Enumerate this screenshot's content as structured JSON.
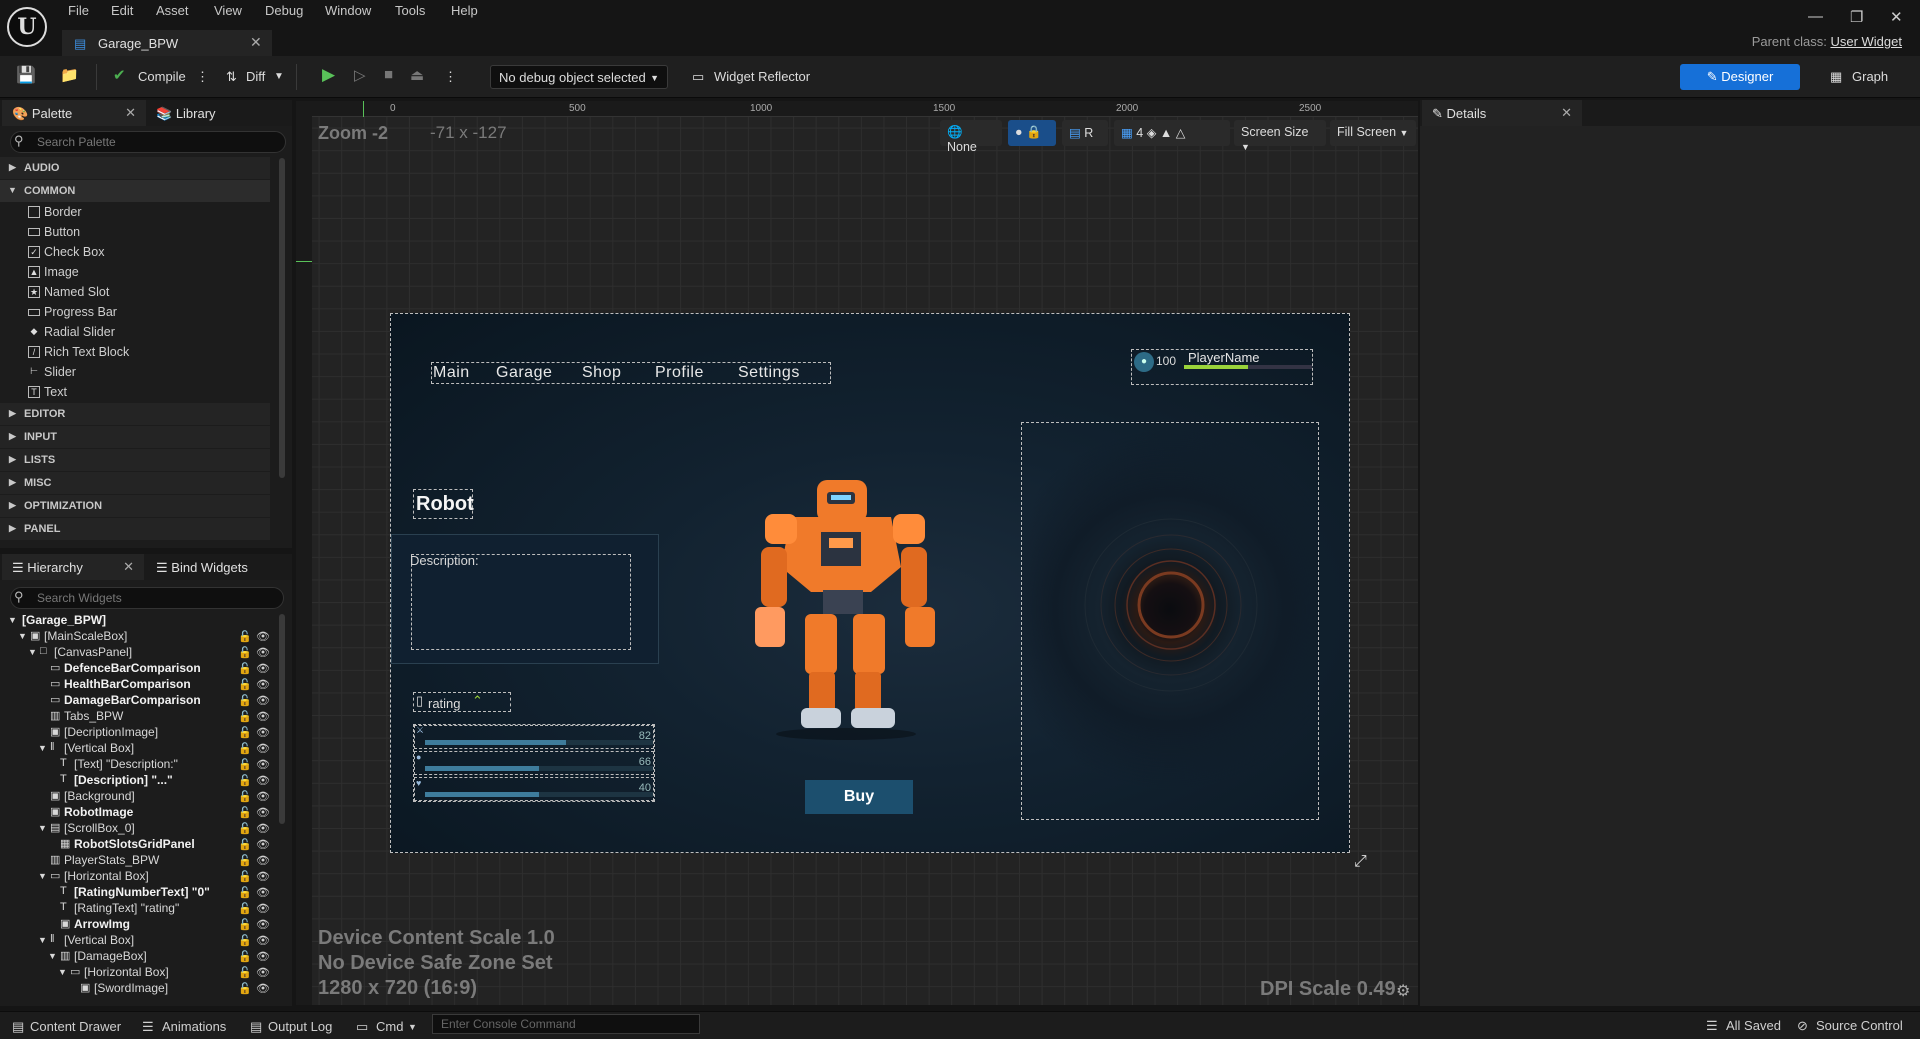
{
  "menu": [
    "File",
    "Edit",
    "Asset",
    "View",
    "Debug",
    "Window",
    "Tools",
    "Help"
  ],
  "document_tab": "Garage_BPW",
  "parent_class_label": "Parent class:",
  "parent_class_value": "User Widget",
  "toolbar": {
    "compile": "Compile",
    "diff": "Diff",
    "debug_object": "No debug object selected",
    "widget_reflector": "Widget Reflector",
    "designer": "Designer",
    "graph": "Graph"
  },
  "palette": {
    "tab": "Palette",
    "library_tab": "Library",
    "search_placeholder": "Search Palette",
    "categories": [
      "AUDIO",
      "COMMON",
      "EDITOR",
      "INPUT",
      "LISTS",
      "MISC",
      "OPTIMIZATION",
      "PANEL"
    ],
    "common_items": [
      "Border",
      "Button",
      "Check Box",
      "Image",
      "Named Slot",
      "Progress Bar",
      "Radial Slider",
      "Rich Text Block",
      "Slider",
      "Text"
    ]
  },
  "hierarchy": {
    "tab": "Hierarchy",
    "bind_tab": "Bind Widgets",
    "search_placeholder": "Search Widgets",
    "rows": [
      {
        "label": "[Garage_BPW]",
        "bold": true
      },
      {
        "label": "[MainScaleBox]",
        "bold": false
      },
      {
        "label": "[CanvasPanel]",
        "bold": false
      },
      {
        "label": "DefenceBarComparison",
        "bold": true
      },
      {
        "label": "HealthBarComparison",
        "bold": true
      },
      {
        "label": "DamageBarComparison",
        "bold": true
      },
      {
        "label": "Tabs_BPW",
        "bold": false
      },
      {
        "label": "[DecriptionImage]",
        "bold": false
      },
      {
        "label": "[Vertical Box]",
        "bold": false
      },
      {
        "label": "[Text] \"Description:\"",
        "bold": false
      },
      {
        "label": "[Description] \"...\"",
        "bold": true
      },
      {
        "label": "[Background]",
        "bold": false
      },
      {
        "label": "RobotImage",
        "bold": true
      },
      {
        "label": "[ScrollBox_0]",
        "bold": false
      },
      {
        "label": "RobotSlotsGridPanel",
        "bold": true
      },
      {
        "label": "PlayerStats_BPW",
        "bold": false
      },
      {
        "label": "[Horizontal Box]",
        "bold": false
      },
      {
        "label": "[RatingNumberText] \"0\"",
        "bold": true
      },
      {
        "label": "[RatingText] \"rating\"",
        "bold": false
      },
      {
        "label": "ArrowImg",
        "bold": true
      },
      {
        "label": "[Vertical Box]",
        "bold": false
      },
      {
        "label": "[DamageBox]",
        "bold": false
      },
      {
        "label": "[Horizontal Box]",
        "bold": false
      },
      {
        "label": "[SwordImage]",
        "bold": false
      }
    ]
  },
  "details": {
    "tab": "Details"
  },
  "viewport": {
    "zoom": "Zoom -2",
    "coords": "-71 x -127",
    "none_btn": "None",
    "r_btn": "R",
    "grid_num": "4",
    "screen_size": "Screen Size",
    "fill_screen": "Fill Screen",
    "ruler_ticks": [
      "0",
      "500",
      "1000",
      "1500",
      "2000",
      "2500"
    ],
    "scale_info": "Device Content Scale 1.0",
    "safe_zone": "No Device Safe Zone Set",
    "resolution": "1280 x 720 (16:9)",
    "dpi": "DPI Scale 0.49"
  },
  "canvas": {
    "nav": [
      "Main",
      "Garage",
      "Shop",
      "Profile",
      "Settings"
    ],
    "player_level": "100",
    "player_name": "PlayerName",
    "robot_title": "Robot",
    "description_label": "Description:",
    "rating_label": "rating",
    "stat_values": [
      "82",
      "66",
      "40"
    ],
    "stat_fill": [
      0.62,
      0.5,
      0.5
    ],
    "buy": "Buy"
  },
  "statusbar": {
    "content_drawer": "Content Drawer",
    "animations": "Animations",
    "output_log": "Output Log",
    "cmd": "Cmd",
    "console_placeholder": "Enter Console Command",
    "all_saved": "All Saved",
    "source_control": "Source Control"
  },
  "colors": {
    "accent": "#1670d8",
    "canvas_bg": "#0f1c28",
    "buy_bg": "#1c4f6e",
    "robot_orange": "#f07a2a"
  }
}
